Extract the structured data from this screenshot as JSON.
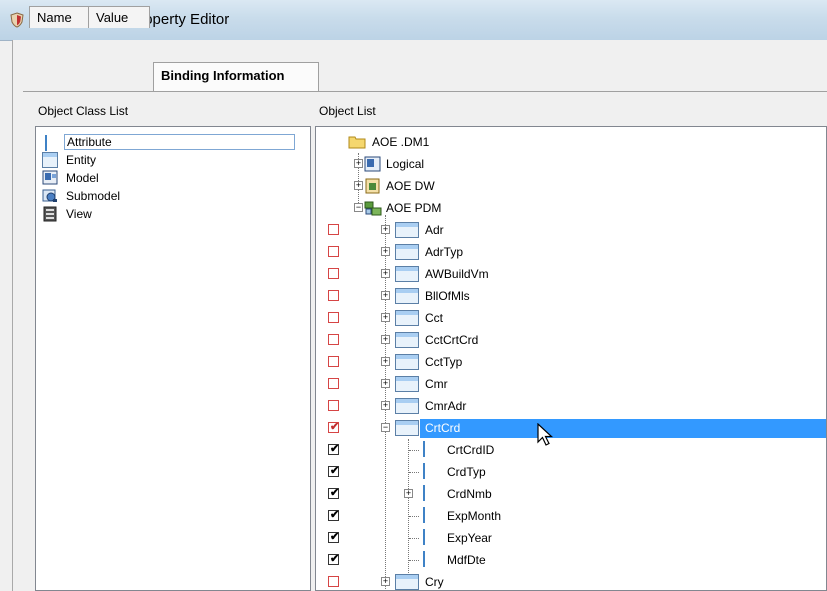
{
  "window": {
    "title": "Data Security Property Editor"
  },
  "tabs": [
    {
      "label": "Name",
      "active": false
    },
    {
      "label": "Value",
      "active": false
    },
    {
      "label": "Binding Information",
      "active": true
    }
  ],
  "object_class_list": {
    "label": "Object Class List",
    "items": [
      {
        "label": "Attribute",
        "icon": "attribute-icon",
        "selected": true
      },
      {
        "label": "Entity",
        "icon": "entity-icon",
        "selected": false
      },
      {
        "label": "Model",
        "icon": "model-icon",
        "selected": false
      },
      {
        "label": "Submodel",
        "icon": "submodel-icon",
        "selected": false
      },
      {
        "label": "View",
        "icon": "view-icon",
        "selected": false
      }
    ]
  },
  "object_list": {
    "label": "Object List",
    "root": "AOE .DM1",
    "nodes": {
      "logical": "Logical",
      "aoe_dw": "AOE DW",
      "aoe_pdm": "AOE PDM"
    },
    "entities": [
      {
        "label": "Adr",
        "checked": false
      },
      {
        "label": "AdrTyp",
        "checked": false
      },
      {
        "label": "AWBuildVm",
        "checked": false
      },
      {
        "label": "BllOfMls",
        "checked": false
      },
      {
        "label": "Cct",
        "checked": false
      },
      {
        "label": "CctCrtCrd",
        "checked": false
      },
      {
        "label": "CctTyp",
        "checked": false
      },
      {
        "label": "Cmr",
        "checked": false
      },
      {
        "label": "CmrAdr",
        "checked": false
      },
      {
        "label": "CrtCrd",
        "checked": true,
        "selected": true
      }
    ],
    "attributes": [
      {
        "label": "CrtCrdID",
        "checked": true,
        "expandable": false
      },
      {
        "label": "CrdTyp",
        "checked": true,
        "expandable": false
      },
      {
        "label": "CrdNmb",
        "checked": true,
        "expandable": true
      },
      {
        "label": "ExpMonth",
        "checked": true,
        "expandable": false
      },
      {
        "label": "ExpYear",
        "checked": true,
        "expandable": false
      },
      {
        "label": "MdfDte",
        "checked": true,
        "expandable": false
      }
    ],
    "after": [
      {
        "label": "Cry",
        "checked": false
      }
    ]
  },
  "colors": {
    "selection": "#3399ff",
    "unchecked_border": "#d64545",
    "checked_border": "#333333"
  }
}
